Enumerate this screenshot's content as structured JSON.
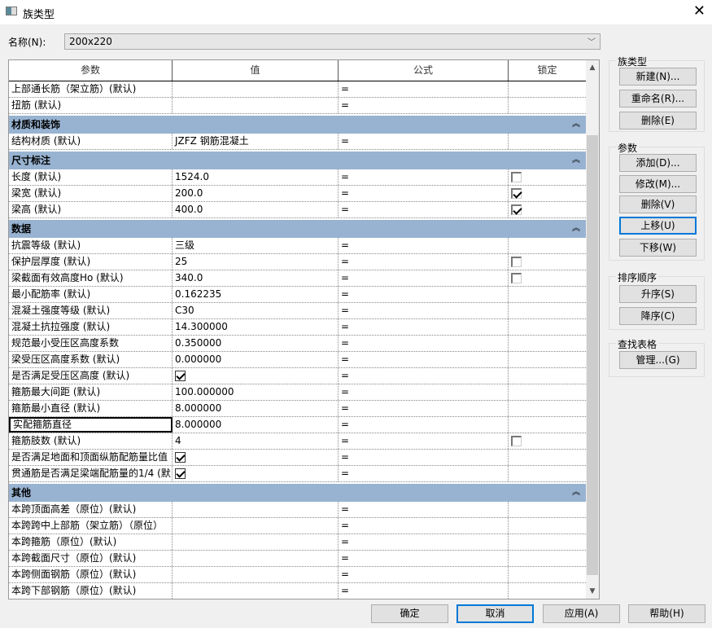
{
  "window": {
    "title": "族类型",
    "close": "✕"
  },
  "name": {
    "label": "名称(N):",
    "value": "200x220"
  },
  "table": {
    "headers": [
      "参数",
      "值",
      "公式",
      "锁定"
    ],
    "sections": [
      {
        "group": null,
        "rows": [
          {
            "param": "上部通长筋（架立筋）(默认)",
            "value": "",
            "formula": "="
          },
          {
            "param": "扭筋 (默认)",
            "value": "",
            "formula": "="
          }
        ]
      },
      {
        "group": "材质和装饰",
        "rows": [
          {
            "param": "结构材质 (默认)",
            "value": "JZFZ 钢筋混凝土",
            "formula": "="
          }
        ]
      },
      {
        "group": "尺寸标注",
        "rows": [
          {
            "param": "长度 (默认)",
            "value": "1524.0",
            "formula": "=",
            "lock": false
          },
          {
            "param": "梁宽 (默认)",
            "value": "200.0",
            "formula": "=",
            "lock": true
          },
          {
            "param": "梁高 (默认)",
            "value": "400.0",
            "formula": "=",
            "lock": true
          }
        ]
      },
      {
        "group": "数据",
        "rows": [
          {
            "param": "抗震等级 (默认)",
            "value": "三级",
            "formula": "="
          },
          {
            "param": "保护层厚度 (默认)",
            "value": "25",
            "formula": "=",
            "lock": false
          },
          {
            "param": "梁截面有效高度Ho (默认)",
            "value": "340.0",
            "formula": "=",
            "lock": false
          },
          {
            "param": "最小配筋率 (默认)",
            "value": "0.162235",
            "formula": "="
          },
          {
            "param": "混凝土强度等级 (默认)",
            "value": "C30",
            "formula": "="
          },
          {
            "param": "混凝土抗拉强度 (默认)",
            "value": "14.300000",
            "formula": "="
          },
          {
            "param": "规范最小受压区高度系数",
            "value": "0.350000",
            "formula": "="
          },
          {
            "param": "梁受压区高度系数 (默认)",
            "value": "0.000000",
            "formula": "="
          },
          {
            "param": "是否满足受压区高度 (默认)",
            "check": true,
            "formula": "="
          },
          {
            "param": "箍筋最大间距 (默认)",
            "value": "100.000000",
            "formula": "="
          },
          {
            "param": "箍筋最小直径 (默认)",
            "value": "8.000000",
            "formula": "="
          },
          {
            "param": "实配箍筋直径",
            "value": "8.000000",
            "formula": "=",
            "selected": true
          },
          {
            "param": "箍筋肢数 (默认)",
            "value": "4",
            "formula": "=",
            "lock": false
          },
          {
            "param": "是否满足地面和顶面纵筋配筋量比值",
            "check": true,
            "formula": "="
          },
          {
            "param": "贯通筋是否满足梁端配筋量的1/4 (默",
            "check": true,
            "formula": "="
          }
        ]
      },
      {
        "group": "其他",
        "rows": [
          {
            "param": "本跨顶面高差（原位）(默认)",
            "value": "",
            "formula": "="
          },
          {
            "param": "本跨跨中上部筋（架立筋）（原位）",
            "value": "",
            "formula": "="
          },
          {
            "param": "本跨箍筋（原位）(默认)",
            "value": "",
            "formula": "="
          },
          {
            "param": "本跨截面尺寸（原位）(默认)",
            "value": "",
            "formula": "="
          },
          {
            "param": "本跨侧面钢筋（原位）(默认)",
            "value": "",
            "formula": "="
          },
          {
            "param": "本跨下部钢筋（原位）(默认)",
            "value": "",
            "formula": "="
          }
        ]
      }
    ]
  },
  "panels": {
    "family_types": {
      "label": "族类型",
      "new": "新建(N)...",
      "rename": "重命名(R)...",
      "delete": "删除(E)"
    },
    "parameters": {
      "label": "参数",
      "add": "添加(D)...",
      "modify": "修改(M)...",
      "delete": "删除(V)",
      "up": "上移(U)",
      "down": "下移(W)"
    },
    "sort": {
      "label": "排序顺序",
      "asc": "升序(S)",
      "desc": "降序(C)"
    },
    "lookup": {
      "label": "查找表格",
      "manage": "管理...(G)"
    }
  },
  "footer": {
    "ok": "确定",
    "cancel": "取消",
    "apply": "应用(A)",
    "help": "帮助(H)"
  }
}
